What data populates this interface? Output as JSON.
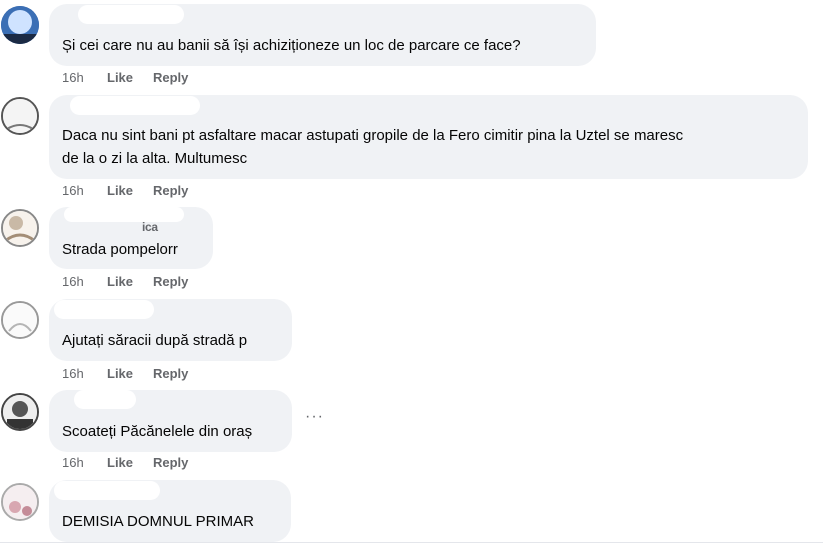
{
  "comments": [
    {
      "text": "Și cei care nu au banii să își achiziționeze un loc de parcare ce face?",
      "time": "16h",
      "like": "Like",
      "reply": "Reply"
    },
    {
      "text_line1": "Daca nu sint bani pt asfaltare macar astupati gropile de la Fero cimitir pina la Uztel se maresc",
      "text_line2": "de la o zi la alta. Multumesc",
      "time": "16h",
      "like": "Like",
      "reply": "Reply"
    },
    {
      "name_fragment": "ica",
      "text": "Strada pompelorr",
      "time": "16h",
      "like": "Like",
      "reply": "Reply"
    },
    {
      "text": "Ajutați săracii după stradă p",
      "time": "16h",
      "like": "Like",
      "reply": "Reply"
    },
    {
      "text": "Scoateți Păcănelele din oraș",
      "time": "16h",
      "like": "Like",
      "reply": "Reply",
      "more": "···"
    },
    {
      "text": "DEMISIA DOMNUL PRIMAR"
    }
  ]
}
